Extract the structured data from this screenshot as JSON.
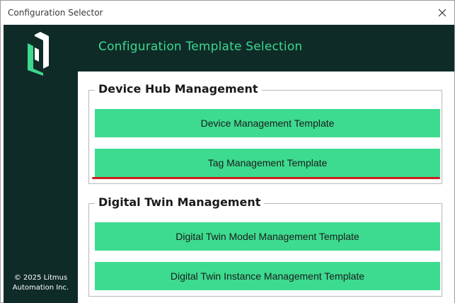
{
  "window": {
    "title": "Configuration Selector"
  },
  "sidebar": {
    "copyright_line1": "© 2025 Litmus",
    "copyright_line2": "Automation Inc."
  },
  "header": {
    "title": "Configuration Template Selection"
  },
  "groups": [
    {
      "label": "Device Hub Management",
      "buttons": [
        "Device Management Template",
        "Tag Management Template"
      ]
    },
    {
      "label": "Digital Twin Management",
      "buttons": [
        "Digital Twin Model Management Template",
        "Digital Twin Instance Management Template"
      ]
    }
  ],
  "colors": {
    "sidebar_bg": "#0f2b28",
    "accent": "#3cd98f",
    "button_bg": "#3ddb8f",
    "highlight_line": "#c91e1e"
  },
  "icons": {
    "logo": "litmus-logo-icon",
    "close": "close-icon"
  }
}
